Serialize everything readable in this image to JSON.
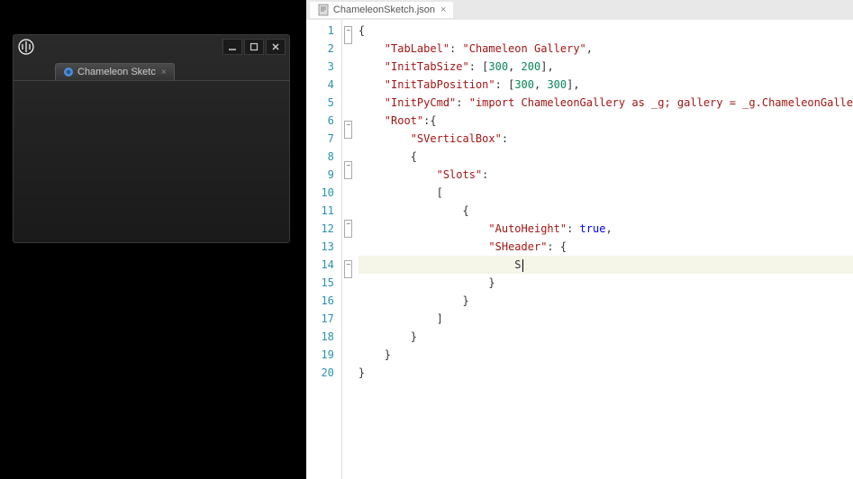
{
  "left": {
    "ue_tab_label": "Chameleon Sketc",
    "min_label": "—",
    "max_label": "▭",
    "close_label": "×"
  },
  "editor": {
    "tab_filename": "ChameleonSketch.json",
    "line_count": 20,
    "lines": [
      {
        "indent": 0,
        "tokens": [
          [
            "punc",
            "{"
          ]
        ]
      },
      {
        "indent": 1,
        "tokens": [
          [
            "key",
            "\"TabLabel\""
          ],
          [
            "punc",
            ": "
          ],
          [
            "str",
            "\"Chameleon Gallery\""
          ],
          [
            "punc",
            ","
          ]
        ]
      },
      {
        "indent": 1,
        "tokens": [
          [
            "key",
            "\"InitTabSize\""
          ],
          [
            "punc",
            ": ["
          ],
          [
            "num",
            "300"
          ],
          [
            "punc",
            ", "
          ],
          [
            "num",
            "200"
          ],
          [
            "punc",
            "],"
          ]
        ]
      },
      {
        "indent": 1,
        "tokens": [
          [
            "key",
            "\"InitTabPosition\""
          ],
          [
            "punc",
            ": ["
          ],
          [
            "num",
            "300"
          ],
          [
            "punc",
            ", "
          ],
          [
            "num",
            "300"
          ],
          [
            "punc",
            "],"
          ]
        ]
      },
      {
        "indent": 1,
        "tokens": [
          [
            "key",
            "\"InitPyCmd\""
          ],
          [
            "punc",
            ": "
          ],
          [
            "str",
            "\"import ChameleonGallery as _g; gallery = _g.ChameleonGalle"
          ]
        ]
      },
      {
        "indent": 1,
        "tokens": [
          [
            "key",
            "\"Root\""
          ],
          [
            "punc",
            ":{"
          ]
        ]
      },
      {
        "indent": 2,
        "tokens": [
          [
            "key",
            "\"SVerticalBox\""
          ],
          [
            "punc",
            ":"
          ]
        ]
      },
      {
        "indent": 2,
        "tokens": [
          [
            "punc",
            "{"
          ]
        ]
      },
      {
        "indent": 3,
        "tokens": [
          [
            "key",
            "\"Slots\""
          ],
          [
            "punc",
            ":"
          ]
        ]
      },
      {
        "indent": 3,
        "tokens": [
          [
            "punc",
            "["
          ]
        ]
      },
      {
        "indent": 4,
        "tokens": [
          [
            "punc",
            "{"
          ]
        ]
      },
      {
        "indent": 5,
        "tokens": [
          [
            "key",
            "\"AutoHeight\""
          ],
          [
            "punc",
            ": "
          ],
          [
            "kw",
            "true"
          ],
          [
            "punc",
            ","
          ]
        ]
      },
      {
        "indent": 5,
        "tokens": [
          [
            "key",
            "\"SHeader\""
          ],
          [
            "punc",
            ": {"
          ]
        ]
      },
      {
        "indent": 6,
        "hl": true,
        "tokens": [
          [
            "err",
            "S"
          ]
        ]
      },
      {
        "indent": 5,
        "tokens": [
          [
            "punc",
            "}"
          ]
        ]
      },
      {
        "indent": 4,
        "tokens": [
          [
            "punc",
            "}"
          ]
        ]
      },
      {
        "indent": 3,
        "tokens": [
          [
            "punc",
            "]"
          ]
        ]
      },
      {
        "indent": 2,
        "tokens": [
          [
            "punc",
            "}"
          ]
        ]
      },
      {
        "indent": 1,
        "tokens": [
          [
            "punc",
            "}"
          ]
        ]
      },
      {
        "indent": 0,
        "tokens": [
          [
            "punc",
            "}"
          ]
        ]
      }
    ]
  }
}
